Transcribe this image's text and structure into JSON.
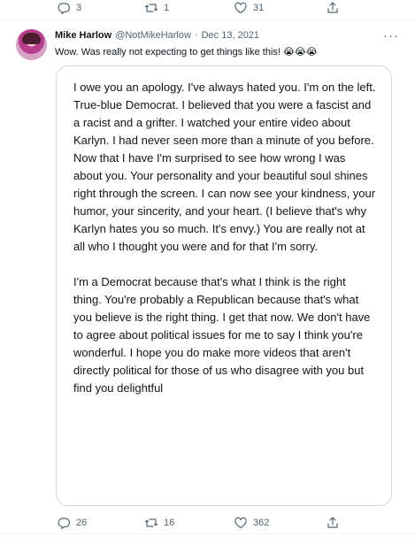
{
  "previous_tweet": {
    "reply_count": "3",
    "retweet_count": "1",
    "like_count": "31"
  },
  "tweet": {
    "author_name": "Mike Harlow",
    "author_handle": "@NotMikeHarlow",
    "separator": "·",
    "date": "Dec 13, 2021",
    "text": "Wow. Was really not expecting to get things like this! 😭😭😭",
    "more_icon": "···",
    "attached_message": {
      "paragraph_1": "I owe you an apology. I've always hated you. I'm on the left. True-blue Democrat. I believed that you were a fascist and a racist and a grifter. I watched your entire video about Karlyn. I had never seen more than a minute of you before. Now that I have I'm surprised to see how wrong I was about you. Your personality and your beautiful soul shines right through the screen. I can now see your kindness, your humor, your sincerity, and your heart. (I believe that's why Karlyn hates you so much. It's envy.) You are really not at all who I thought you were and for that I'm sorry.",
      "paragraph_2": "I'm a Democrat because that's what I think is the right thing. You're probably a Republican because that's what you believe is the right thing. I get that now. We don't have to agree about political issues for me to say I think you're wonderful. I hope you do make more videos that aren't directly political for those of us who disagree with you but find you delightful"
    },
    "reply_count": "26",
    "retweet_count": "16",
    "like_count": "362"
  },
  "icons": {
    "reply": "reply-icon",
    "retweet": "retweet-icon",
    "like": "heart-icon",
    "share": "share-icon",
    "more": "more-icon"
  },
  "colors": {
    "text": "#0f1419",
    "secondary": "#536471",
    "border": "#cfd9de",
    "background": "#f7f9f9"
  }
}
